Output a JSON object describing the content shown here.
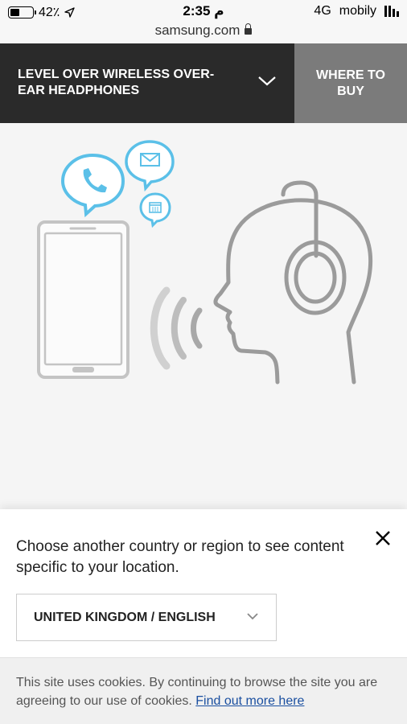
{
  "status_bar": {
    "battery": "42٪",
    "battery_level": 0.42,
    "time": "2:35 م",
    "network": "4G",
    "carrier": "mobily"
  },
  "browser": {
    "url": "samsung.com"
  },
  "product_bar": {
    "title": "LEVEL OVER WIRELESS OVER-EAR HEADPHONES",
    "where_to_buy": "WHERE TO BUY"
  },
  "colors": {
    "dark_bar": "#2a2a2a",
    "where_buy_bg": "#7b7b7b",
    "illustration_blue": "#5bc0e8",
    "illustration_gray": "#9b9b9b",
    "link": "#1a4fa0"
  },
  "country_panel": {
    "message": "Choose another country or region to see content specific to your location.",
    "selected_country": "UNITED KINGDOM / ENGLISH"
  },
  "cookie_bar": {
    "text": "This site uses cookies. By continuing to browse the site you are agreeing to our use of cookies.",
    "link_text": "Find out more here"
  }
}
